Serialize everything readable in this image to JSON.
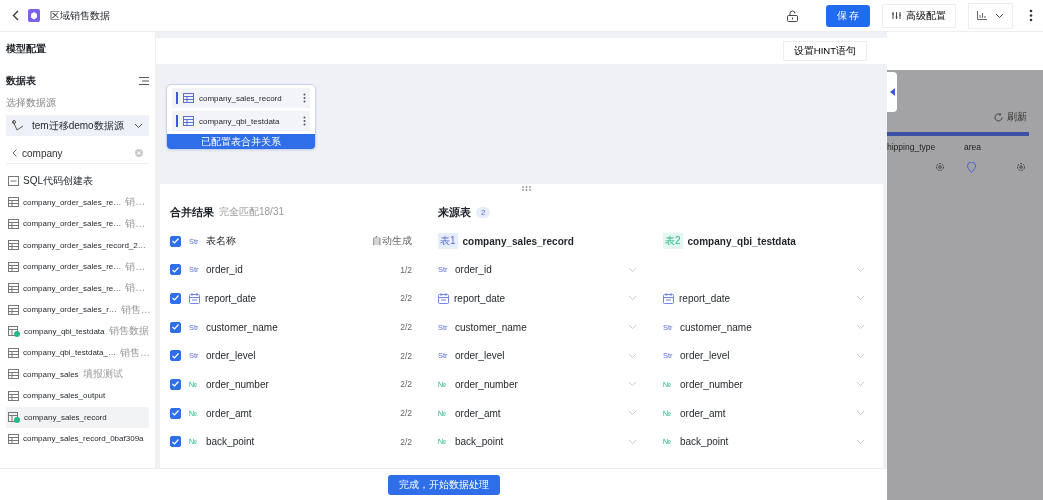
{
  "topbar": {
    "title": "区域销售数据",
    "save": "保 存",
    "advanced": "高级配置"
  },
  "sidebar": {
    "section": "模型配置",
    "tables_title": "数据表",
    "source_label": "选择数据源",
    "source": "tem迁移demo数据源",
    "search": "company",
    "items": [
      {
        "kind": "sql",
        "name": "SQL代码创建表",
        "selected": false
      },
      {
        "kind": "table",
        "name": "company_order_sales_re…",
        "note": "销…",
        "selected": false
      },
      {
        "kind": "table",
        "name": "company_order_sales_re…",
        "note": "销…",
        "selected": false
      },
      {
        "kind": "table",
        "name": "company_order_sales_record_2…",
        "selected": false
      },
      {
        "kind": "table",
        "name": "company_order_sales_re…",
        "note": "销…",
        "selected": false
      },
      {
        "kind": "table",
        "name": "company_order_sales_re…",
        "note": "销…",
        "selected": false
      },
      {
        "kind": "table",
        "name": "company_order_sales_r…",
        "note": "销售…",
        "selected": false
      },
      {
        "kind": "linked",
        "name": "company_qbi_testdata",
        "note": "销售数据",
        "selected": false
      },
      {
        "kind": "table",
        "name": "company_qbi_testdata_…",
        "note": "销售…",
        "selected": false
      },
      {
        "kind": "table",
        "name": "company_sales",
        "note": "填报测试",
        "selected": false
      },
      {
        "kind": "table",
        "name": "company_sales_output",
        "selected": false
      },
      {
        "kind": "linked",
        "name": "company_sales_record",
        "selected": true
      },
      {
        "kind": "table",
        "name": "company_sales_record_0baf309a",
        "selected": false
      }
    ]
  },
  "hint_button": "设置HINT语句",
  "canvas": {
    "tables": [
      "company_sales_record",
      "company_qbi_testdata"
    ],
    "caption": "已配置表合并关系"
  },
  "merge": {
    "title": "合并结果",
    "match": "完全匹配18/31",
    "sources_title": "来源表",
    "sources_count": "2",
    "name_row": {
      "checked": true,
      "type": {
        "kind": "str",
        "label": "Str"
      },
      "name": "表名称",
      "note": "自动生成"
    },
    "sources": [
      {
        "tag": "表1",
        "name": "company_sales_record"
      },
      {
        "tag": "表2",
        "name": "company_qbi_testdata"
      }
    ],
    "rows": [
      {
        "checked": true,
        "type": {
          "kind": "str",
          "label": "Str"
        },
        "name": "order_id",
        "count": "1/2",
        "src": [
          {
            "kind": "str",
            "label": "Str",
            "name": "order_id"
          },
          {
            "kind": "empty"
          }
        ]
      },
      {
        "checked": true,
        "type": {
          "kind": "date"
        },
        "name": "report_date",
        "count": "2/2",
        "src": [
          {
            "kind": "date",
            "name": "report_date"
          },
          {
            "kind": "date",
            "name": "report_date"
          }
        ]
      },
      {
        "checked": true,
        "type": {
          "kind": "str",
          "label": "Str"
        },
        "name": "customer_name",
        "count": "2/2",
        "src": [
          {
            "kind": "str",
            "label": "Str",
            "name": "customer_name"
          },
          {
            "kind": "str",
            "label": "Str",
            "name": "customer_name"
          }
        ]
      },
      {
        "checked": true,
        "type": {
          "kind": "str",
          "label": "Str"
        },
        "name": "order_level",
        "count": "2/2",
        "src": [
          {
            "kind": "str",
            "label": "Str",
            "name": "order_level"
          },
          {
            "kind": "str",
            "label": "Str",
            "name": "order_level"
          }
        ]
      },
      {
        "checked": true,
        "type": {
          "kind": "number",
          "label": "№"
        },
        "name": "order_number",
        "count": "2/2",
        "src": [
          {
            "kind": "number",
            "label": "№",
            "name": "order_number"
          },
          {
            "kind": "number",
            "label": "№",
            "name": "order_number"
          }
        ]
      },
      {
        "checked": true,
        "type": {
          "kind": "number",
          "label": "№"
        },
        "name": "order_amt",
        "count": "2/2",
        "src": [
          {
            "kind": "number",
            "label": "№",
            "name": "order_amt"
          },
          {
            "kind": "number",
            "label": "№",
            "name": "order_amt"
          }
        ]
      },
      {
        "checked": true,
        "type": {
          "kind": "number",
          "label": "№"
        },
        "name": "back_point",
        "count": "2/2",
        "src": [
          {
            "kind": "number",
            "label": "№",
            "name": "back_point"
          },
          {
            "kind": "number",
            "label": "№",
            "name": "back_point"
          }
        ]
      }
    ]
  },
  "finish_button": "完成，开始数据处理",
  "drawer": {
    "refresh": "刷新",
    "columns": [
      "hipping_type",
      "area"
    ]
  }
}
